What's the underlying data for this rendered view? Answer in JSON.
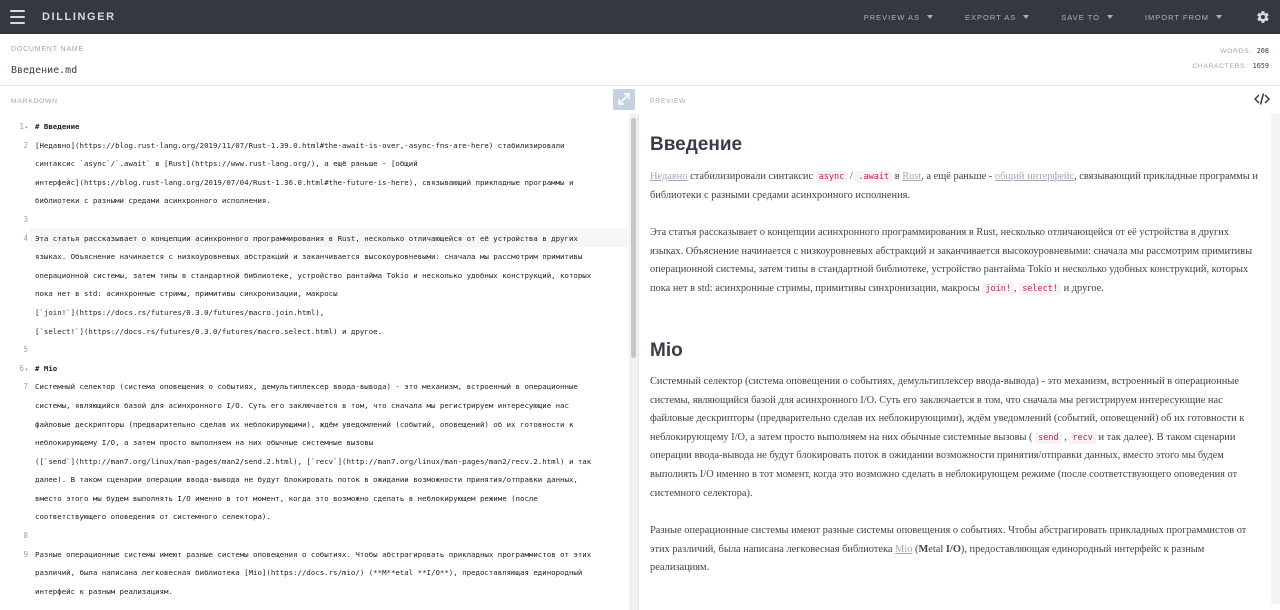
{
  "app": {
    "brand": "DILLINGER"
  },
  "nav": {
    "items": [
      {
        "label": "PREVIEW AS"
      },
      {
        "label": "EXPORT AS"
      },
      {
        "label": "SAVE TO"
      },
      {
        "label": "IMPORT FROM"
      }
    ]
  },
  "document": {
    "label": "DOCUMENT NAME",
    "name": "Введение.md",
    "words_label": "WORDS:",
    "words": "208",
    "chars_label": "CHARACTERS:",
    "chars": "1659"
  },
  "panes": {
    "markdown_label": "MARKDOWN",
    "preview_label": "PREVIEW"
  },
  "editor": {
    "gutter": [
      {
        "n": "1",
        "fold": true,
        "row": 0
      },
      {
        "n": "2",
        "fold": false,
        "row": 1
      },
      {
        "n": "3",
        "fold": false,
        "row": 5
      },
      {
        "n": "4",
        "fold": false,
        "row": 6
      },
      {
        "n": "5",
        "fold": false,
        "row": 12
      },
      {
        "n": "6",
        "fold": true,
        "row": 13
      },
      {
        "n": "7",
        "fold": false,
        "row": 14
      },
      {
        "n": "8",
        "fold": false,
        "row": 22
      },
      {
        "n": "9",
        "fold": false,
        "row": 23
      }
    ],
    "lines": [
      "# Введение",
      "[Недавно](https://blog.rust-lang.org/2019/11/07/Rust-1.39.0.html#the-await-is-over,-async-fns-are-here) стабилизировали",
      "синтаксис `async`/`.await` в [Rust](https://www.rust-lang.org/), а ещё раньше - [общий",
      "интерфейс](https://blog.rust-lang.org/2019/07/04/Rust-1.36.0.html#the-future-is-here), связывающий прикладные программы и",
      "библиотеки с разными средами асинхронного исполнения.",
      "",
      "Эта статья рассказывает о концепции асинхронного программирования в Rust, несколько отличающейся от её устройства в других",
      "языках. Объяснение начинается с низкоуровневых абстракций и заканчивается высокоуровневыми: сначала мы рассмотрим примитивы",
      "операционной системы, затем типы в стандартной библиотеке, устройство рантайма Tokio и несколько удобных конструкций, которых",
      "пока нет в std: асинхронные стримы, примитивы синхронизации, макросы",
      "[`join!`](https://docs.rs/futures/0.3.0/futures/macro.join.html),",
      "[`select!`](https://docs.rs/futures/0.3.0/futures/macro.select.html) и другое.",
      "",
      "# Mio",
      "Системный селектор (система оповещения о событиях, демультиплексер ввода-вывода) - это механизм, встроенный в операционные",
      "системы, являющийся базой для асинхронного I/O. Суть его заключается в том, что сначала мы регистрируем интересующие нас",
      "файловые дескрипторы (предварительно сделав их неблокирующими), ждём уведомлений (событий, оповещений) об их готовности к",
      "неблокирующему I/O, а затем просто выполняем на них обычные системные вызовы",
      "([`send`](http://man7.org/linux/man-pages/man2/send.2.html), [`recv`](http://man7.org/linux/man-pages/man2/recv.2.html) и так",
      "далее). В таком сценарии операции ввода-вывода не будут блокировать поток в ожидании возможности принятия/отправки данных,",
      "вместо этого мы будем выполнять I/O именно в тот момент, когда это возможно сделать в неблокирующем режиме  (после",
      "соответствующего оповедения от системного селектора).",
      "",
      "Разные операционные системы имеют разные системы оповещения о событиях. Чтобы абстрагировать прикладных программистов от этих",
      "различий, была написана легковесная библиотека [Mio](https://docs.rs/mio/) (**M**etal **I/O**), предоставляющая единородный",
      "интерфейс к разным реализациям."
    ]
  },
  "preview": {
    "h1": "Введение",
    "p1": {
      "link1": "Недавно",
      "t1": " стабилизировали синтаксис ",
      "c1": "async",
      "t2": " / ",
      "c2": ".await",
      "t3": " в ",
      "link2": "Rust",
      "t4": ", а ещё раньше - ",
      "link3": "общий интерфейс",
      "t5": ", связывающий прикладные программы и библиотеки с разными средами асинхронного исполнения."
    },
    "p2": {
      "t1": "Эта статья рассказывает о концепции асинхронного программирования в Rust, несколько отличающейся от её устройства в других языках. Объяснение начинается с низкоуровневых абстракций и заканчивается высокоуровневыми: сначала мы рассмотрим примитивы операционной системы, затем типы в стандартной библиотеке, устройство рантайма Tokio и несколько удобных конструкций, которых пока нет в std: асинхронные стримы, примитивы синхронизации, макросы ",
      "c1": "join!",
      "t2": ", ",
      "c2": "select!",
      "t3": " и другое."
    },
    "h2": "Mio",
    "p3": {
      "t1": "Системный селектор (система оповещения о событиях, демультиплексер ввода-вывода) - это механизм, встроенный в операционные системы, являющийся базой для асинхронного I/O. Суть его заключается в том, что сначала мы регистрируем интересующие нас файловые дескрипторы (предварительно сделав их неблокирующими), ждём уведомлений (событий, оповещений) об их готовности к неблокирующему I/O, а затем просто выполняем на них обычные системные вызовы ( ",
      "c1": "send",
      "t2": " , ",
      "c2": "recv",
      "t3": " и так далее). В таком сценарии операции ввода-вывода не будут блокировать поток в ожидании возможности принятия/отправки данных, вместо этого мы будем выполнять I/O именно в тот момент, когда это возможно сделать в неблокирующем режиме (после соответствующего оповедения от системного селектора)."
    },
    "p4": {
      "t1": "Разные операционные системы имеют разные системы оповещения о событиях. Чтобы абстрагировать прикладных программистов от этих различий, была написана легковесная библиотека ",
      "link1": "Mio",
      "t2": " (",
      "b1": "M",
      "t3": "etal ",
      "b2": "I/O",
      "t4": "), предоставляющая единородный интерфейс к разным реализациям."
    }
  }
}
